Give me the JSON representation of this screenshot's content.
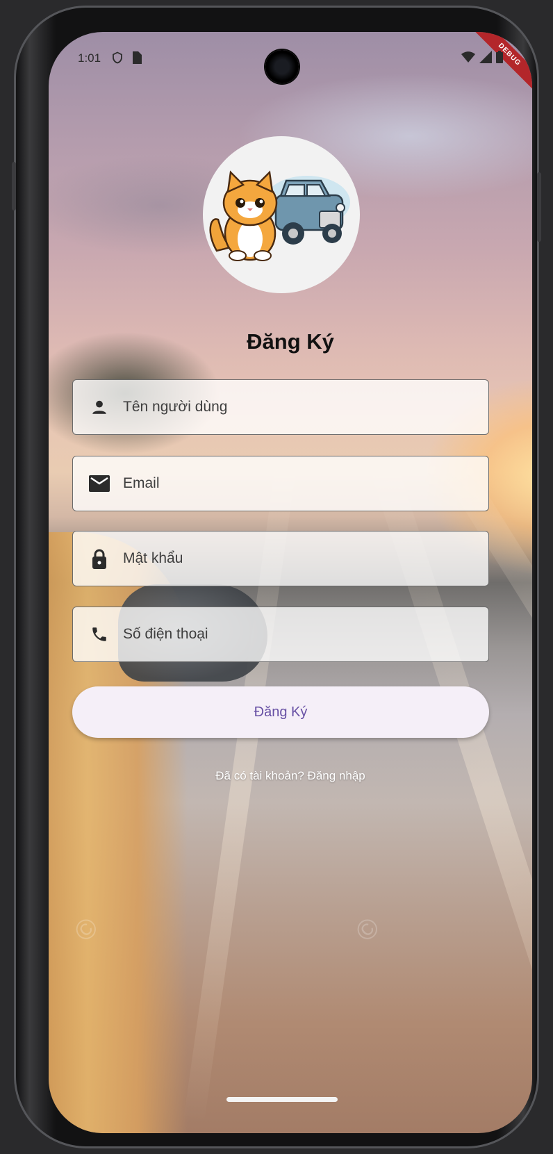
{
  "status_bar": {
    "time": "1:01",
    "debug_label": "DEBUG"
  },
  "form": {
    "title": "Đăng Ký",
    "fields": [
      {
        "icon": "person-icon",
        "placeholder": "Tên người dùng"
      },
      {
        "icon": "mail-icon",
        "placeholder": "Email"
      },
      {
        "icon": "lock-icon",
        "placeholder": "Mật khẩu"
      },
      {
        "icon": "phone-icon",
        "placeholder": "Số điện thoại"
      }
    ],
    "submit_label": "Đăng Ký",
    "login_link": "Đã có tài khoản? Đăng nhập"
  },
  "colors": {
    "button_bg": "#f5eff8",
    "button_text": "#6750a4",
    "debug_ribbon": "#b3262a"
  }
}
